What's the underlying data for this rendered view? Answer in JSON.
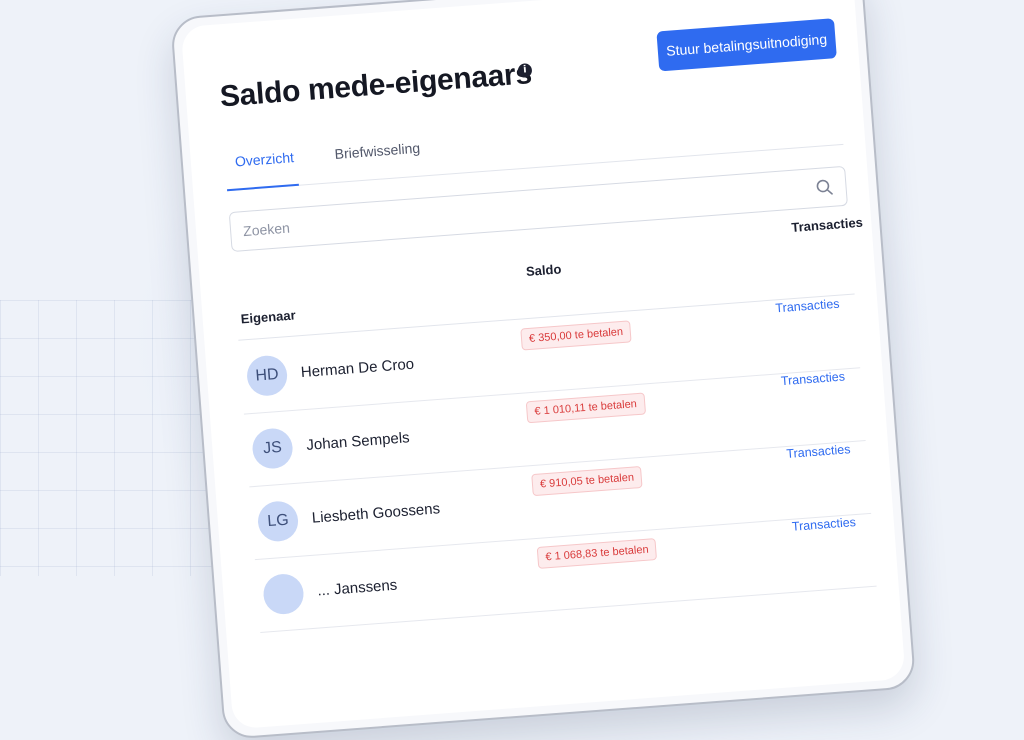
{
  "header": {
    "title": "Saldo mede-eigenaars",
    "invite_button": "Stuur betalingsuitnodiging"
  },
  "tabs": [
    {
      "label": "Overzicht",
      "active": true
    },
    {
      "label": "Briefwisseling",
      "active": false
    }
  ],
  "search": {
    "placeholder": "Zoeken"
  },
  "table": {
    "columns": {
      "owner": "Eigenaar",
      "saldo": "Saldo",
      "transactions": "Transacties"
    },
    "rows": [
      {
        "initials": "HD",
        "name": "Herman De Croo",
        "saldo": "€ 350,00 te betalen",
        "link": "Transacties"
      },
      {
        "initials": "JS",
        "name": "Johan Sempels",
        "saldo": "€ 1 010,11 te betalen",
        "link": "Transacties"
      },
      {
        "initials": "LG",
        "name": "Liesbeth Goossens",
        "saldo": "€ 910,05 te betalen",
        "link": "Transacties"
      },
      {
        "initials": "",
        "name": "... Janssens",
        "saldo": "€ 1 068,83 te betalen",
        "link": "Transacties"
      }
    ]
  },
  "colors": {
    "accent": "#2f6bf0",
    "debt_text": "#d93a3a",
    "debt_bg": "#fdeced",
    "avatar_bg": "#c9d8f7"
  },
  "icons": {
    "info": "info-icon",
    "search": "search-icon"
  }
}
